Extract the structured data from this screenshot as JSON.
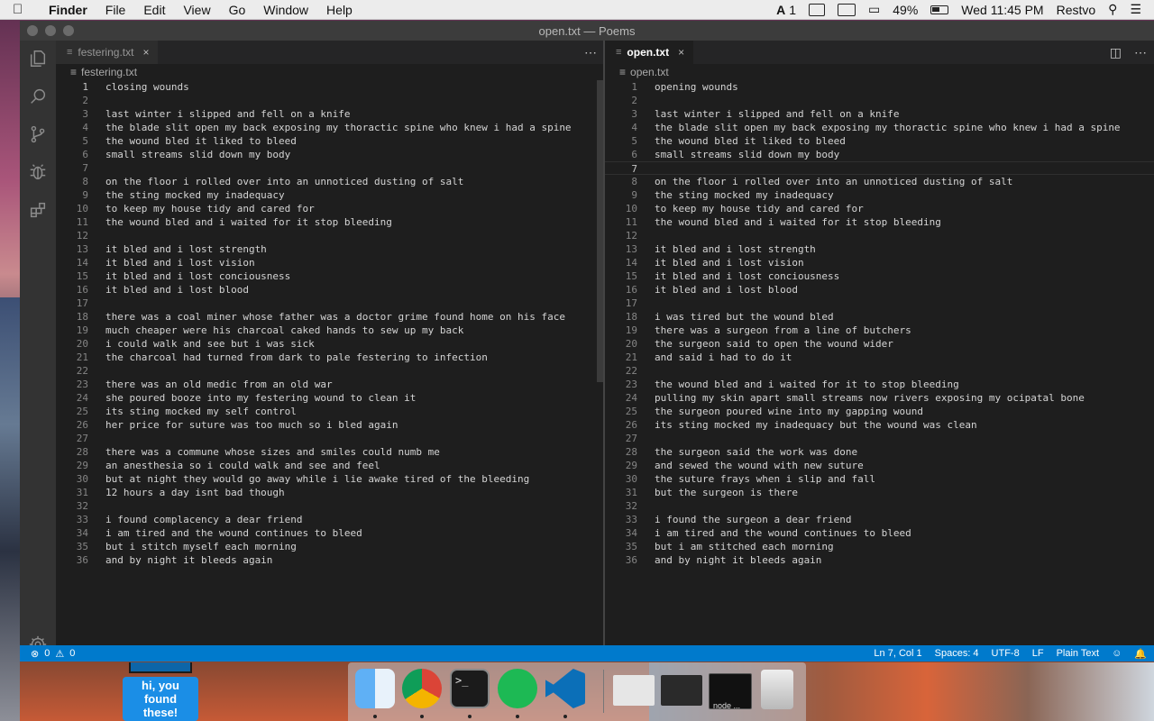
{
  "menubar": {
    "app": "Finder",
    "items": [
      "File",
      "Edit",
      "View",
      "Go",
      "Window",
      "Help"
    ],
    "status": {
      "input_badge": "1",
      "battery": "49%",
      "clock": "Wed 11:45 PM",
      "user": "Restvo"
    }
  },
  "window": {
    "title": "open.txt — Poems"
  },
  "left_editor": {
    "tab": "festering.txt",
    "breadcrumb": "festering.txt",
    "lines": [
      "closing wounds",
      "",
      "last winter i slipped and fell on a knife",
      "the blade slit open my back exposing my thoractic spine who knew i had a spine",
      "the wound bled it liked to bleed",
      "small streams slid down my body",
      "",
      "on the floor i rolled over into an unnoticed dusting of salt",
      "the sting mocked my inadequacy",
      "to keep my house tidy and cared for",
      "the wound bled and i waited for it stop bleeding",
      "",
      "it bled and i lost strength",
      "it bled and i lost vision",
      "it bled and i lost conciousness",
      "it bled and i lost blood",
      "",
      "there was a coal miner whose father was a doctor grime found home on his face",
      "much cheaper were his charcoal caked hands to sew up my back",
      "i could walk and see but i was sick",
      "the charcoal had turned from dark to pale festering to infection",
      "",
      "there was an old medic from an old war",
      "she poured booze into my festering wound to clean it",
      "its sting mocked my self control",
      "her price for suture was too much so i bled again",
      "",
      "there was a commune whose sizes and smiles could numb me",
      "an anesthesia so i could walk and see and feel",
      "but at night they would go away while i lie awake tired of the bleeding",
      "12 hours a day isnt bad though",
      "",
      "i found complacency a dear friend",
      "i am tired and the wound continues to bleed",
      "but i stitch myself each morning",
      "and by night it bleeds again"
    ]
  },
  "right_editor": {
    "tab": "open.txt",
    "breadcrumb": "open.txt",
    "lines": [
      "opening wounds",
      "",
      "last winter i slipped and fell on a knife",
      "the blade slit open my back exposing my thoractic spine who knew i had a spine",
      "the wound bled it liked to bleed",
      "small streams slid down my body",
      "",
      "on the floor i rolled over into an unnoticed dusting of salt",
      "the sting mocked my inadequacy",
      "to keep my house tidy and cared for",
      "the wound bled and i waited for it stop bleeding",
      "",
      "it bled and i lost strength",
      "it bled and i lost vision",
      "it bled and i lost conciousness",
      "it bled and i lost blood",
      "",
      "i was tired but the wound bled",
      "there was a surgeon from a line of butchers",
      "the surgeon said to open the wound wider",
      "and said i had to do it",
      "",
      "the wound bled and i waited for it to stop bleeding",
      "pulling my skin apart small streams now rivers exposing my ocipatal bone",
      "the surgeon poured wine into my gapping wound",
      "its sting mocked my inadequacy but the wound was clean",
      "",
      "the surgeon said the work was done",
      "and sewed the wound with new suture",
      "the suture frays when i slip and fall",
      "but the surgeon is there",
      "",
      "i found the surgeon a dear friend",
      "i am tired and the wound continues to bleed",
      "but i am stitched each morning",
      "and by night it bleeds again"
    ]
  },
  "statusbar": {
    "errors": "0",
    "warnings": "0",
    "position": "Ln 7, Col 1",
    "spaces": "Spaces: 4",
    "encoding": "UTF-8",
    "eol": "LF",
    "language": "Plain Text"
  },
  "tooltip": {
    "text": "hi, you found these!"
  },
  "dock": {
    "thumb_label": "node ..."
  },
  "colors": {
    "statusbar": "#007acc",
    "editor": "#1e1e1e",
    "activitybar": "#333333",
    "tooltip": "#1b8ee6"
  }
}
